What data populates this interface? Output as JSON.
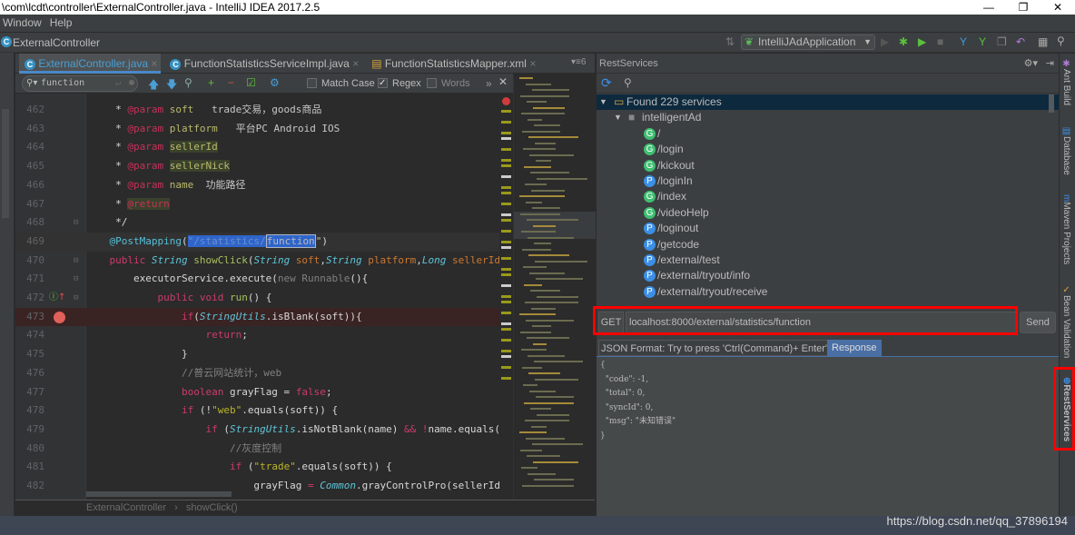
{
  "window": {
    "title": "\\com\\lcdt\\controller\\ExternalController.java - IntelliJ IDEA 2017.2.5",
    "minimize": "—",
    "restore": "❐",
    "close": "✕"
  },
  "menu": [
    "Window",
    "Help"
  ],
  "nav": {
    "breadcrumb": "ExternalController",
    "run_config": "IntelliJAdApplication"
  },
  "tabs": [
    {
      "label": "ExternalController.java",
      "icon": "c",
      "active": true
    },
    {
      "label": "FunctionStatisticsServiceImpl.java",
      "icon": "c"
    },
    {
      "label": "FunctionStatisticsMapper.xml",
      "icon": "xml"
    }
  ],
  "find": {
    "query": "function",
    "match_case": "Match Case",
    "regex": "Regex",
    "words": "Words",
    "match_case_checked": false,
    "regex_checked": true,
    "words_checked": false
  },
  "code": [
    {
      "n": "462",
      "t": [
        [
          "     * ",
          "pl"
        ],
        [
          "@param",
          "tag"
        ],
        [
          " soft",
          "tagv"
        ],
        [
          "   trade交易，goods商品",
          "cn"
        ]
      ]
    },
    {
      "n": "463",
      "t": [
        [
          "     * ",
          "pl"
        ],
        [
          "@param",
          "tag"
        ],
        [
          " platform",
          "tagv"
        ],
        [
          "   平台PC Android IOS",
          "cn"
        ]
      ]
    },
    {
      "n": "464",
      "t": [
        [
          "     * ",
          "pl"
        ],
        [
          "@param",
          "tag"
        ],
        [
          " ",
          "pl"
        ],
        [
          "sellerId",
          "tagv hlb"
        ]
      ]
    },
    {
      "n": "465",
      "t": [
        [
          "     * ",
          "pl"
        ],
        [
          "@param",
          "tag"
        ],
        [
          " ",
          "pl"
        ],
        [
          "sellerNick",
          "tagv hlb"
        ]
      ]
    },
    {
      "n": "466",
      "t": [
        [
          "     * ",
          "pl"
        ],
        [
          "@param",
          "tag"
        ],
        [
          " name",
          "tagv"
        ],
        [
          "  功能路径",
          "cn"
        ]
      ]
    },
    {
      "n": "467",
      "t": [
        [
          "     * ",
          "pl"
        ],
        [
          "@return",
          "tag hlb"
        ]
      ]
    },
    {
      "n": "468",
      "t": [
        [
          "     */",
          "pl"
        ]
      ]
    },
    {
      "n": "469",
      "t": [
        [
          "    ",
          "pl"
        ],
        [
          "@PostMapping",
          "anns"
        ],
        [
          "(",
          "pl"
        ],
        [
          "\"/statistics/",
          "sel"
        ],
        [
          "function",
          "selb"
        ],
        [
          "\"",
          "str"
        ],
        [
          ")",
          "pl"
        ]
      ],
      "current": true
    },
    {
      "n": "470",
      "t": [
        [
          "    ",
          "pl"
        ],
        [
          "public ",
          "kw"
        ],
        [
          "String ",
          "typ"
        ],
        [
          "showClick",
          "fn"
        ],
        [
          "(",
          "pl"
        ],
        [
          "String ",
          "typ"
        ],
        [
          "soft",
          "par"
        ],
        [
          ",",
          "pl"
        ],
        [
          "String ",
          "typ"
        ],
        [
          "platform",
          "par"
        ],
        [
          ",",
          "pl"
        ],
        [
          "Long ",
          "typ"
        ],
        [
          "sellerId",
          "par"
        ],
        [
          ",",
          "pl"
        ]
      ]
    },
    {
      "n": "471",
      "t": [
        [
          "        executorService.execute(",
          "pl"
        ],
        [
          "new ",
          "com"
        ],
        [
          "Runnable",
          "com"
        ],
        [
          "(){",
          "pl"
        ]
      ]
    },
    {
      "n": "472",
      "t": [
        [
          "            ",
          "pl"
        ],
        [
          "public void ",
          "kw"
        ],
        [
          "run",
          "fn"
        ],
        [
          "() {",
          "pl"
        ]
      ]
    },
    {
      "n": "473",
      "t": [
        [
          "                ",
          "pl"
        ],
        [
          "if",
          "kw"
        ],
        [
          "(",
          "pl"
        ],
        [
          "StringUtils",
          "typ"
        ],
        [
          ".isBlank(soft)){",
          "pl"
        ]
      ],
      "breakpoint": true
    },
    {
      "n": "474",
      "t": [
        [
          "                    ",
          "pl"
        ],
        [
          "return",
          "kw"
        ],
        [
          ";",
          "pl"
        ]
      ]
    },
    {
      "n": "475",
      "t": [
        [
          "                }",
          "pl"
        ]
      ]
    },
    {
      "n": "476",
      "t": [
        [
          "                //普云网站统计，web",
          "com"
        ]
      ]
    },
    {
      "n": "477",
      "t": [
        [
          "                ",
          "pl"
        ],
        [
          "boolean ",
          "kw"
        ],
        [
          "grayFlag = ",
          "pl"
        ],
        [
          "false",
          "kw"
        ],
        [
          ";",
          "pl"
        ]
      ]
    },
    {
      "n": "478",
      "t": [
        [
          "                ",
          "pl"
        ],
        [
          "if ",
          "kw"
        ],
        [
          "(!",
          "pl"
        ],
        [
          "\"web\"",
          "ann"
        ],
        [
          ".equals(soft)) {",
          "pl"
        ]
      ]
    },
    {
      "n": "479",
      "t": [
        [
          "                    ",
          "pl"
        ],
        [
          "if ",
          "kw"
        ],
        [
          "(",
          "pl"
        ],
        [
          "StringUtils",
          "typ"
        ],
        [
          ".isNotBlank(name) ",
          "pl"
        ],
        [
          "&& !",
          "kw"
        ],
        [
          "name.equals(",
          "pl"
        ]
      ]
    },
    {
      "n": "480",
      "t": [
        [
          "                        //灰度控制",
          "com"
        ]
      ]
    },
    {
      "n": "481",
      "t": [
        [
          "                        ",
          "pl"
        ],
        [
          "if ",
          "kw"
        ],
        [
          "(",
          "pl"
        ],
        [
          "\"trade\"",
          "ann"
        ],
        [
          ".equals(soft)) {",
          "pl"
        ]
      ]
    },
    {
      "n": "482",
      "t": [
        [
          "                            grayFlag ",
          "pl"
        ],
        [
          "= ",
          "kw"
        ],
        [
          "Common",
          "typ"
        ],
        [
          ".grayControlPro(sellerId,",
          "pl"
        ]
      ]
    }
  ],
  "editor_breadcrumb": {
    "class": "ExternalController",
    "method": "showClick()",
    "sep": "›"
  },
  "rest": {
    "title": "RestServices",
    "root": "Found 229 services",
    "module": "intelligentAd",
    "services": [
      {
        "m": "G",
        "path": "/"
      },
      {
        "m": "G",
        "path": "/login"
      },
      {
        "m": "G",
        "path": "/kickout"
      },
      {
        "m": "P",
        "path": "/loginIn"
      },
      {
        "m": "G",
        "path": "/index"
      },
      {
        "m": "G",
        "path": "/videoHelp"
      },
      {
        "m": "P",
        "path": "/loginout"
      },
      {
        "m": "P",
        "path": "/getcode"
      },
      {
        "m": "P",
        "path": "/external/test"
      },
      {
        "m": "P",
        "path": "/external/tryout/info"
      },
      {
        "m": "P",
        "path": "/external/tryout/receive"
      }
    ],
    "method": "GET",
    "url": "localhost:8000/external/statistics/function",
    "send": "Send",
    "tab_json": "JSON Format: Try to press 'Ctrl(Command)+ Enter'",
    "tab_response": "Response",
    "response": [
      "{",
      "  \"code\": -1,",
      "  \"total\": 0,",
      "  \"syncId\": 0,",
      "  \"msg\": \"未知错误\"",
      "}"
    ]
  },
  "right_tools": [
    "Ant Build",
    "Database",
    "Maven Projects",
    "Bean Validation",
    "RestServices"
  ],
  "colors": {
    "get": "#3fbf72",
    "post": "#3b8fe6",
    "highlight": "#ff0000"
  },
  "watermark": "https://blog.csdn.net/qq_37896194"
}
